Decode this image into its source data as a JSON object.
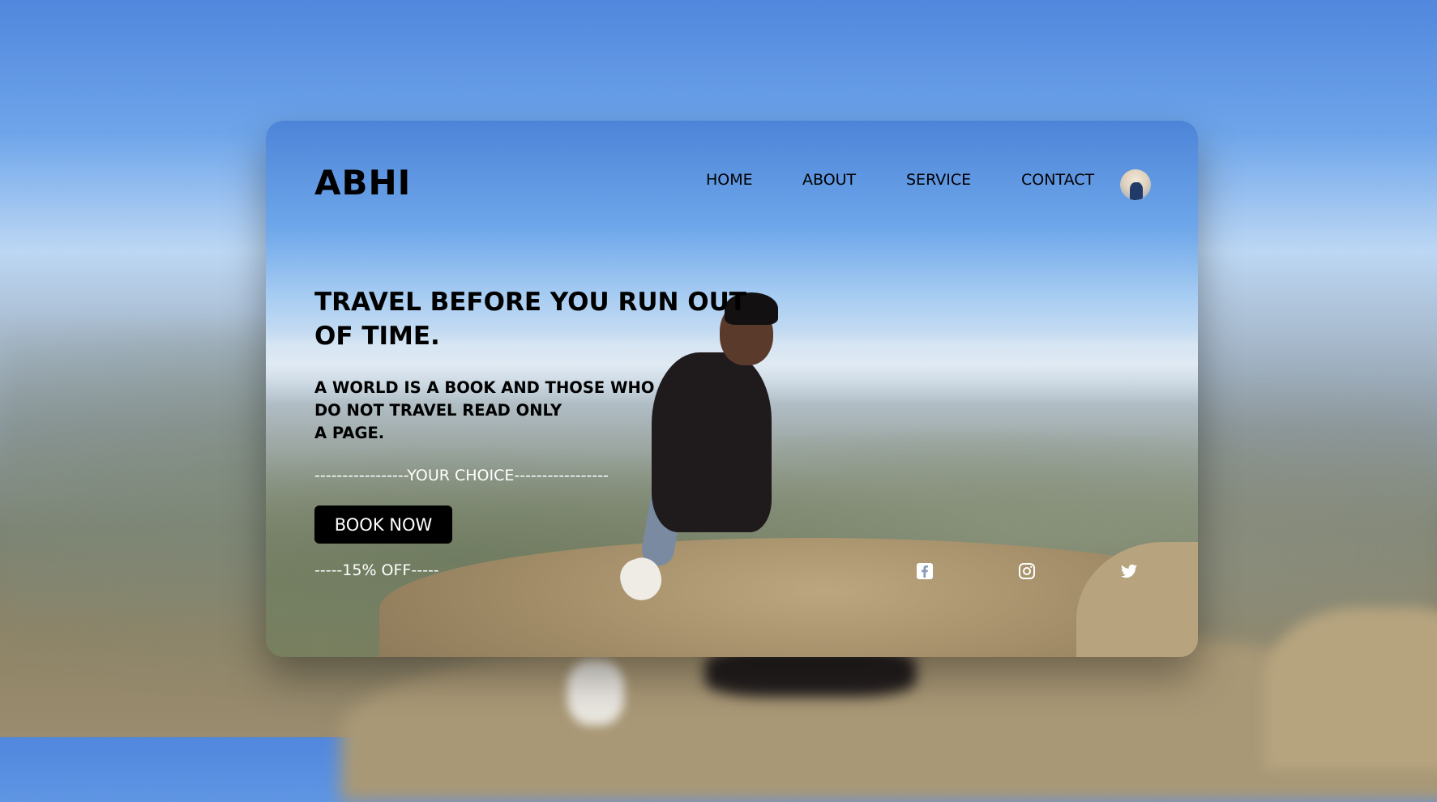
{
  "brand": {
    "logo": "ABHI"
  },
  "nav": {
    "home": "HOME",
    "about": "ABOUT",
    "service": "SERVICE",
    "contact": "CONTACT"
  },
  "hero": {
    "headline": "TRAVEL BEFORE YOU RUN OUT OF TIME.",
    "quote_line1": "A WORLD IS A BOOK AND THOSE WHO",
    "quote_line2": "DO NOT TRAVEL READ ONLY",
    "quote_line3": "A PAGE.",
    "choice_text": "-----------------YOUR CHOICE-----------------",
    "book_button": "BOOK NOW",
    "offer_text": "-----15% OFF-----"
  },
  "social": {
    "icons": [
      "facebook-icon",
      "instagram-icon",
      "twitter-icon"
    ]
  },
  "colors": {
    "text": "#000000",
    "button_bg": "#000000",
    "button_text": "#ffffff",
    "accent_text": "#ffffff"
  }
}
